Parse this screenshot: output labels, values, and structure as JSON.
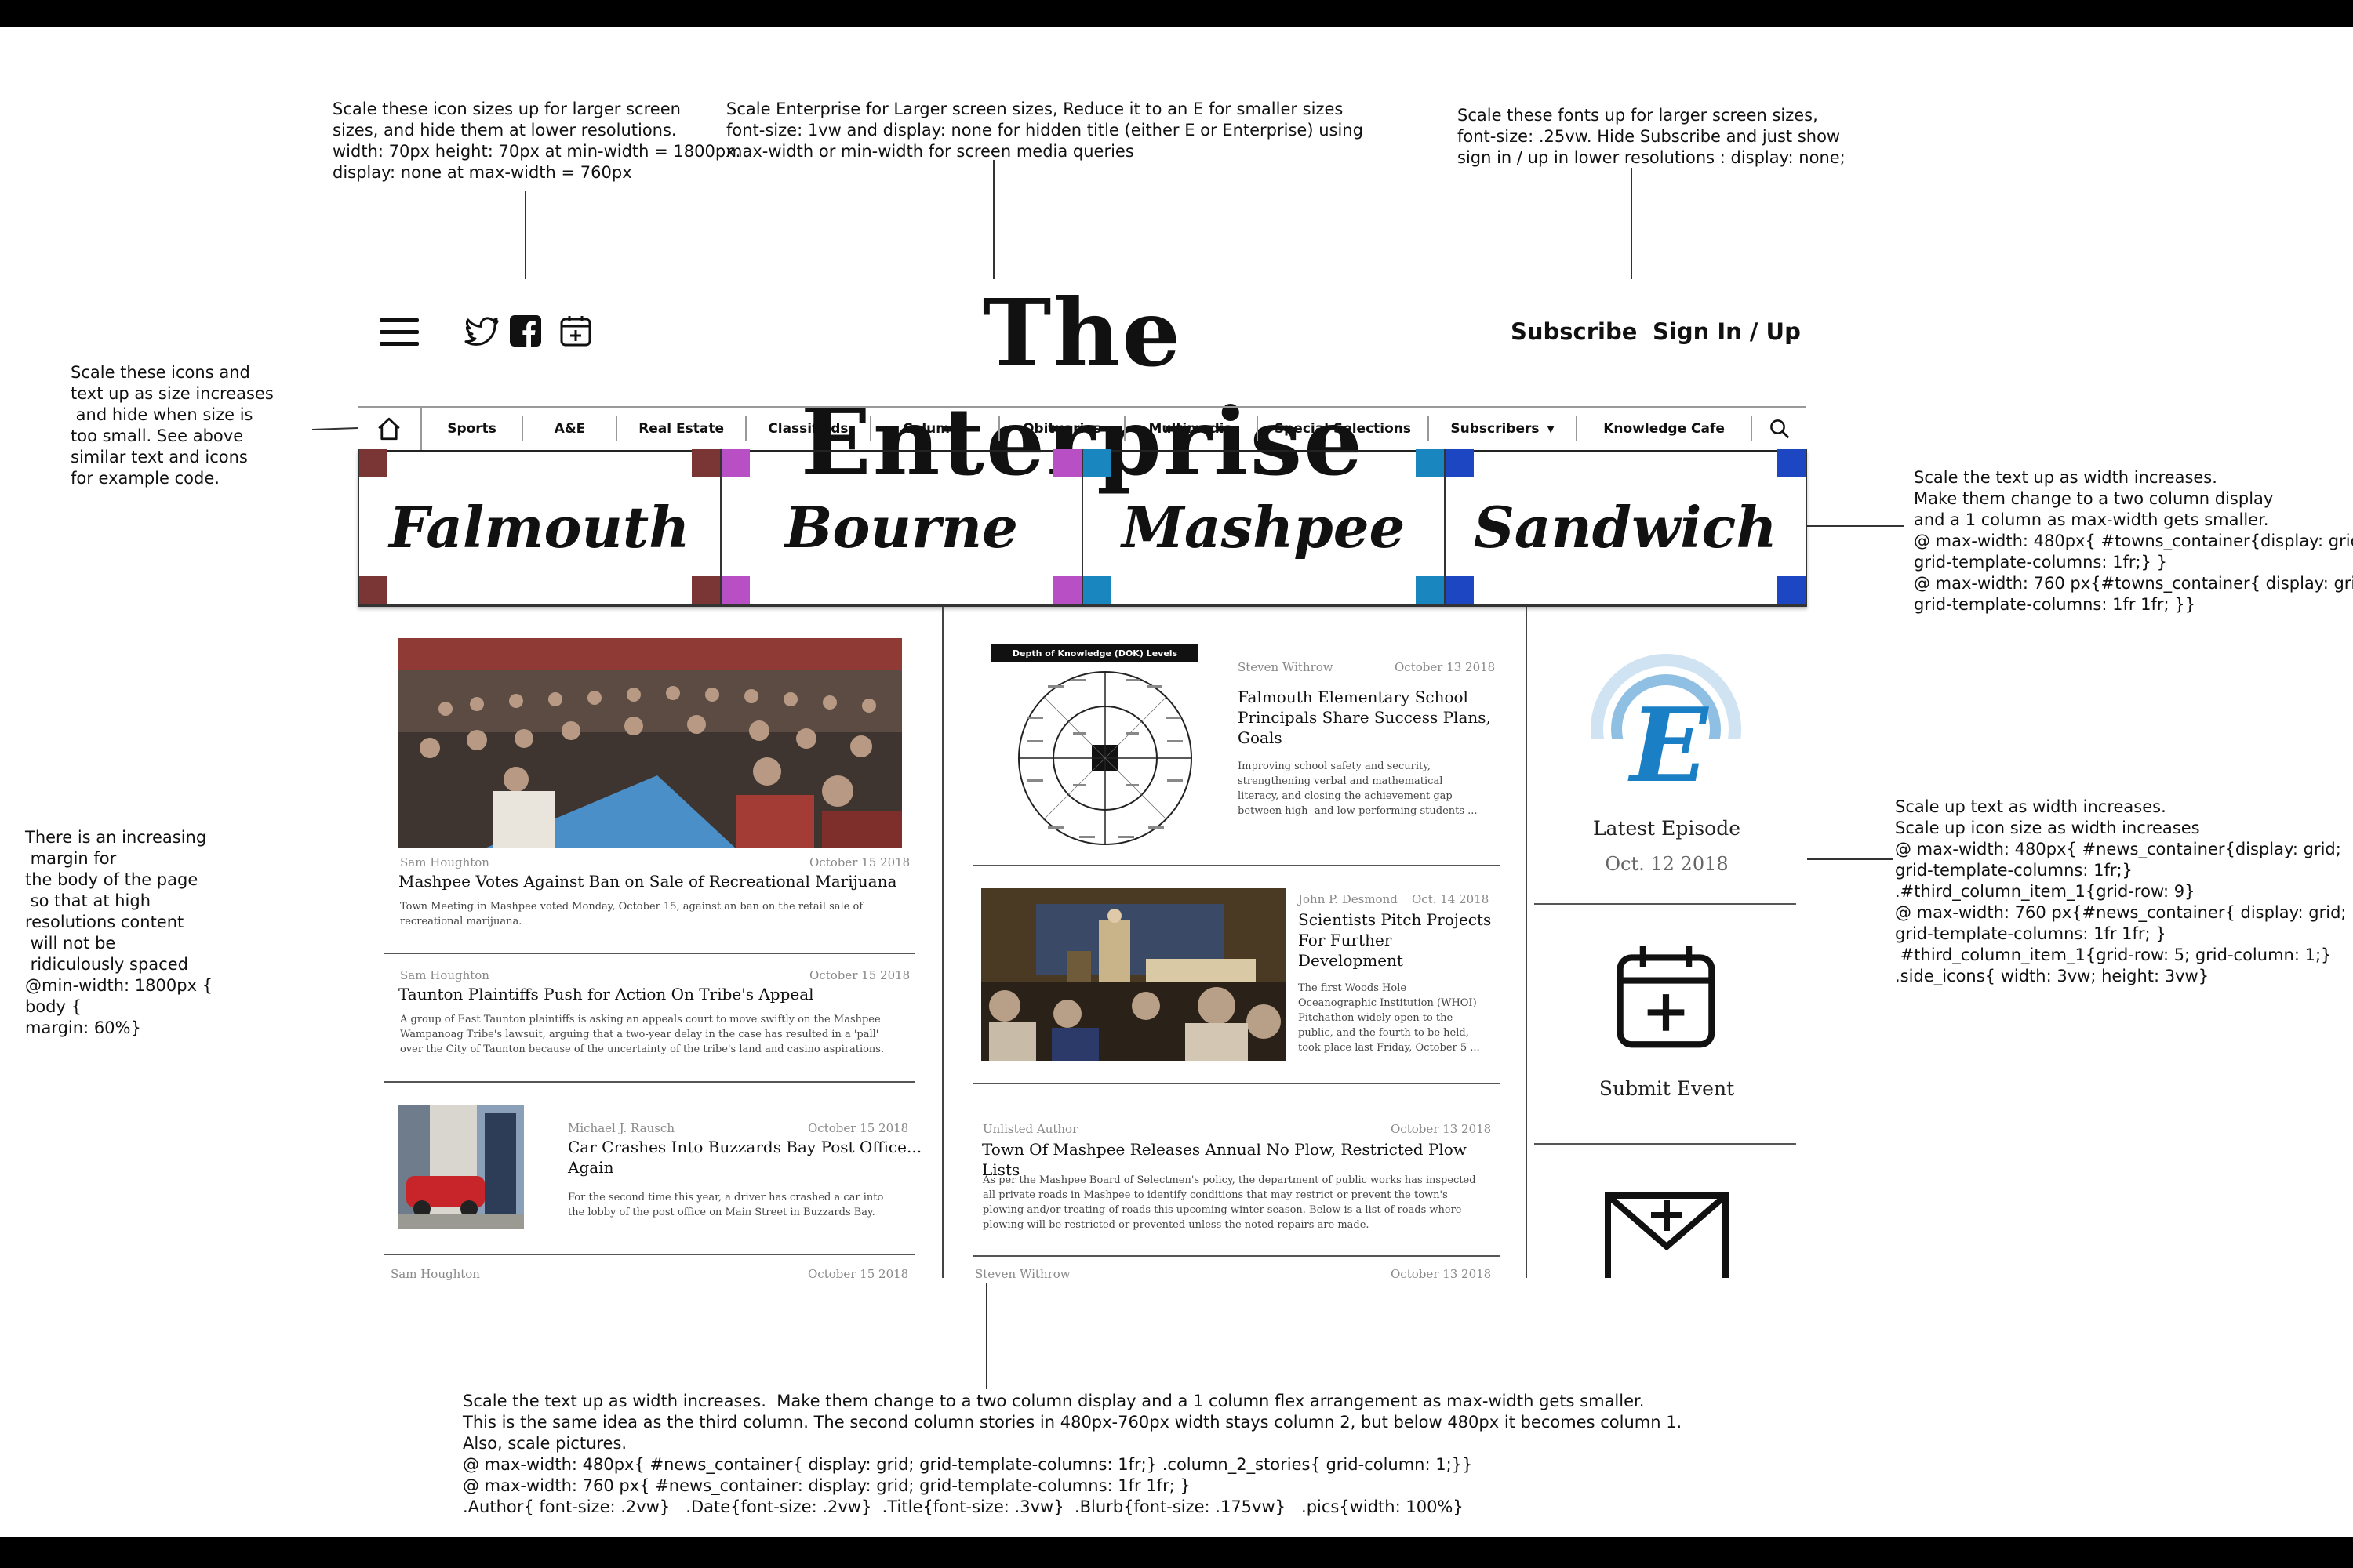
{
  "notes": {
    "icons_top": "Scale these icon sizes up for larger screen\nsizes, and hide them at lower resolutions.\nwidth: 70px height: 70px at min-width = 1800px.\ndisplay: none at max-width = 760px",
    "enterprise": "Scale Enterprise for Larger screen sizes, Reduce it to an E for smaller sizes\nfont-size: 1vw and display: none for hidden title (either E or Enterprise) using\nmax-width or min-width for screen media queries",
    "fonts": "Scale these fonts up for larger screen sizes,\nfont-size: .25vw. Hide Subscribe and just show\nsign in / up in lower resolutions : display: none;",
    "nav_icons": "Scale these icons and\ntext up as size increases\n and hide when size is\ntoo small. See above\nsimilar text and icons\nfor example code.",
    "towns": "Scale the text up as width increases.\nMake them change to a two column display\nand a 1 column as max-width gets smaller.\n@ max-width: 480px{ #towns_container{display: grid;\ngrid-template-columns: 1fr;} }\n@ max-width: 760 px{#towns_container{ display: grid;\ngrid-template-columns: 1fr 1fr; }}",
    "margin": "There is an increasing\n margin for\nthe body of the page\n so that at high\nresolutions content\n will not be\n ridiculously spaced\n@min-width: 1800px {\nbody {\nmargin: 60%}",
    "third_col": "Scale up text as width increases.\nScale up icon size as width increases\n@ max-width: 480px{ #news_container{display: grid;\ngrid-template-columns: 1fr;}\n.#third_column_item_1{grid-row: 9}\n@ max-width: 760 px{#news_container{ display: grid;\ngrid-template-columns: 1fr 1fr; }\n #third_column_item_1{grid-row: 5; grid-column: 1;}\n.side_icons{ width: 3vw; height: 3vw}",
    "bottom": "Scale the text up as width increases.  Make them change to a two column display and a 1 column flex arrangement as max-width gets smaller.\nThis is the same idea as the third column. The second column stories in 480px-760px width stays column 2, but below 480px it becomes column 1.\nAlso, scale pictures.\n@ max-width: 480px{ #news_container{ display: grid; grid-template-columns: 1fr;} .column_2_stories{ grid-column: 1;}}\n@ max-width: 760 px{ #news_container: display: grid; grid-template-columns: 1fr 1fr; }\n.Author{ font-size: .2vw}   .Date{font-size: .2vw}  .Title{font-size: .3vw}  .Blurb{font-size: .175vw}   .pics{width: 100%}"
  },
  "header": {
    "masthead": "The Enterprise",
    "subscribe": "Subscribe",
    "sign_in": "Sign In / Up",
    "icons": [
      "menu-icon",
      "twitter-icon",
      "facebook-icon",
      "calendar-add-icon"
    ]
  },
  "nav": {
    "items": [
      "Sports",
      "A&E",
      "Real Estate",
      "Classifieds",
      "Columns",
      "Obituaries",
      "Multimedia",
      "Special Selections",
      "Subscribers",
      "Knowledge Cafe"
    ]
  },
  "towns": [
    {
      "name": "Falmouth",
      "color": "#7a3535"
    },
    {
      "name": "Bourne",
      "color": "#b84fc4"
    },
    {
      "name": "Mashpee",
      "color": "#1a86c0"
    },
    {
      "name": "Sandwich",
      "color": "#1d47c2"
    }
  ],
  "col1": {
    "a1": {
      "author": "Sam Houghton",
      "date": "October 15 2018",
      "title": "Mashpee Votes Against Ban on Sale of Recreational Marijuana",
      "blurb": "Town Meeting in Mashpee voted Monday, October 15, against an ban on the retail sale of\nrecreational marijuana."
    },
    "a2": {
      "author": "Sam Houghton",
      "date": "October 15 2018",
      "title": "Taunton Plaintiffs Push for Action On Tribe's Appeal",
      "blurb": "A group of East Taunton plaintiffs is asking an appeals court to move swiftly on the Mashpee\nWampanoag Tribe's lawsuit, arguing that a two-year delay in the case has resulted in a 'pall'\nover the City of Taunton because of the uncertainty of the tribe's land and casino aspirations."
    },
    "a3": {
      "author": "Michael J. Rausch",
      "date": "October 15 2018",
      "title": "Car Crashes Into Buzzards Bay Post Office...\nAgain",
      "blurb": "For the second time this year, a driver has crashed a car into\nthe lobby of the post office on Main Street in Buzzards Bay."
    },
    "a4": {
      "author": "Sam Houghton",
      "date": "October 15 2018"
    }
  },
  "col2": {
    "diagram_title": "Depth of Knowledge (DOK) Levels",
    "a1": {
      "author": "Steven Withrow",
      "date": "October 13 2018",
      "title": "Falmouth Elementary School\nPrincipals Share Success Plans,\nGoals",
      "blurb": "Improving school safety and security,\nstrengthening verbal and mathematical\nliteracy, and closing the achievement gap\nbetween high- and low-performing students ..."
    },
    "a2": {
      "author": "John P. Desmond",
      "date": "Oct. 14 2018",
      "title": "Scientists Pitch Projects\nFor Further\nDevelopment",
      "blurb": "The first Woods Hole\nOceanographic Institution (WHOI)\nPitchathon widely open to the\npublic, and the fourth to be held,\ntook place last Friday, October 5 ..."
    },
    "a3": {
      "author": "Unlisted Author",
      "date": "October 13 2018",
      "title": "Town Of Mashpee Releases Annual No Plow, Restricted Plow Lists",
      "blurb": "As per the Mashpee Board of Selectmen's policy, the department of public works has inspected\nall private roads in Mashpee to identify conditions that may restrict or prevent the town's\nplowing and/or treating of roads this upcoming winter season. Below is a list of roads where\nplowing will be restricted or prevented unless the noted repairs are made."
    },
    "a4": {
      "author": "Steven Withrow",
      "date": "October 13 2018"
    }
  },
  "col3": {
    "episode_label": "Latest Episode",
    "episode_date": "Oct. 12 2018",
    "submit_label": "Submit Event",
    "colors": {
      "logo_blue": "#1a7fc4"
    }
  }
}
